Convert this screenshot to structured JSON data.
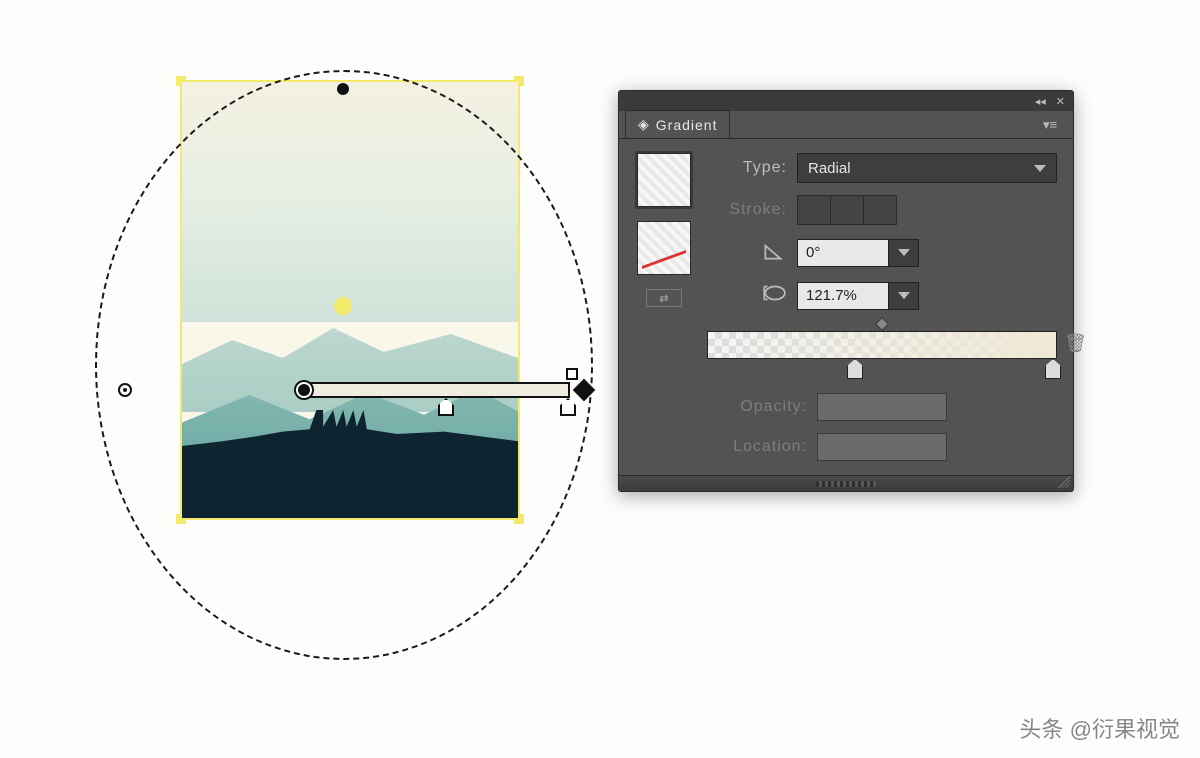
{
  "panel": {
    "title": "Gradient",
    "type_label": "Type:",
    "type_value": "Radial",
    "stroke_label": "Stroke:",
    "angle_value": "0°",
    "aspect_value": "121.7%",
    "opacity_label": "Opacity:",
    "opacity_value": "",
    "location_label": "Location:",
    "location_value": ""
  },
  "icons": {
    "gradient": "◈",
    "collapse": "◂◂",
    "close": "✕",
    "menu": "▾≡",
    "trash": "🗑",
    "link": "⇄"
  },
  "watermark": "头条 @衍果视觉"
}
